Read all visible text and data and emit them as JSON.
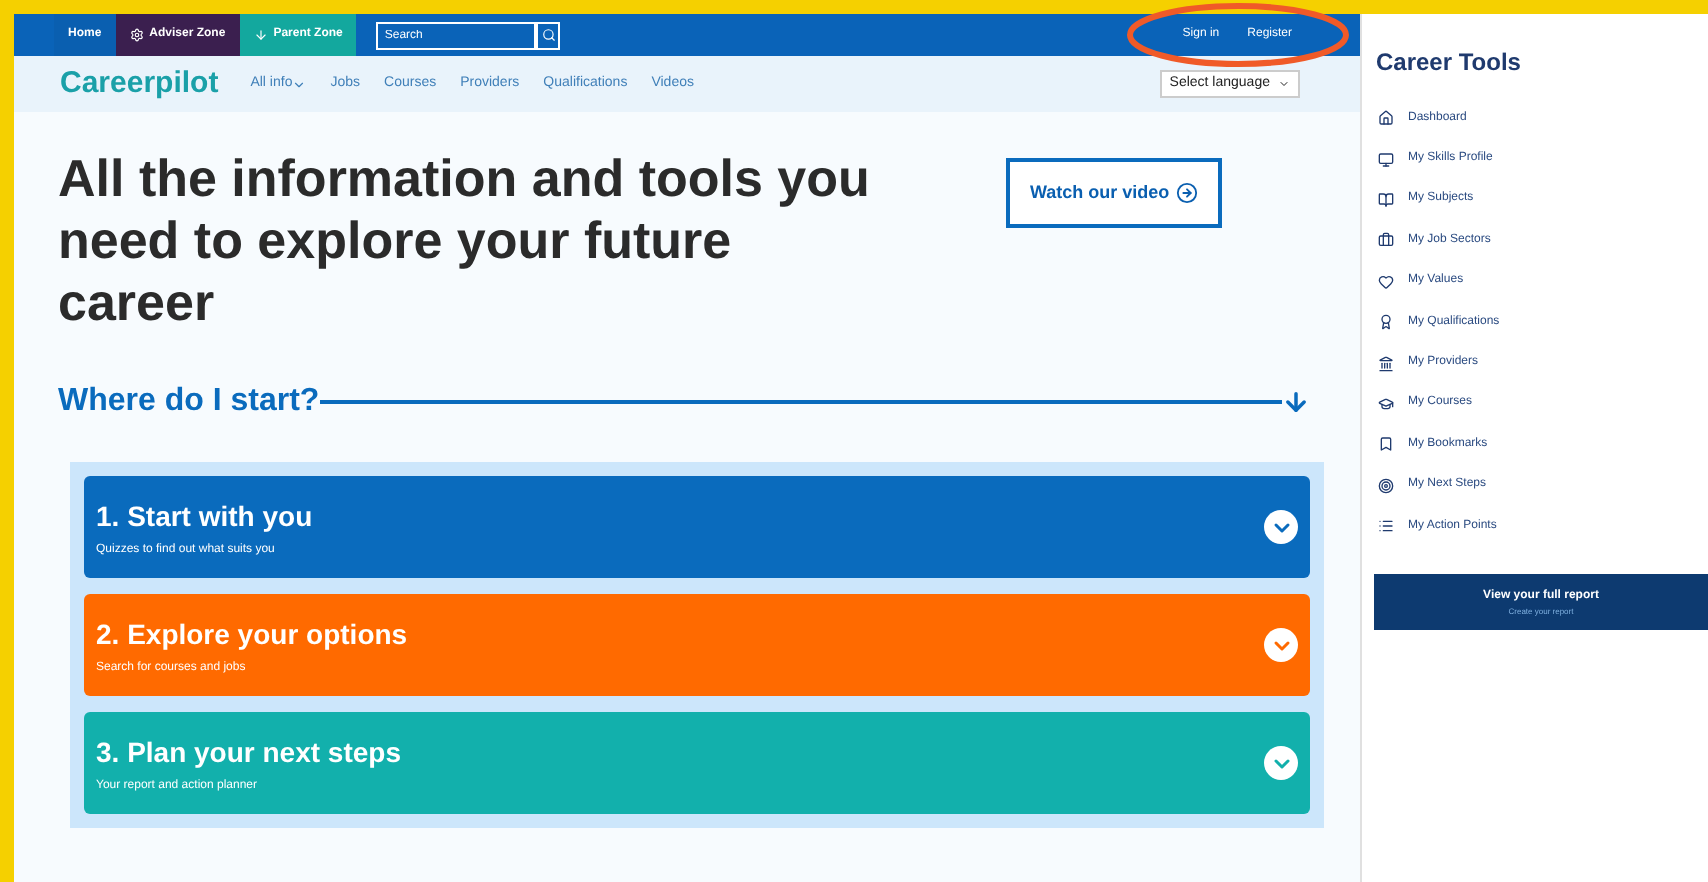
{
  "top_bar": {
    "links": [
      {
        "label": "Home",
        "kind": "plain"
      },
      {
        "label": "Adviser Zone",
        "kind": "adviser"
      },
      {
        "label": "Parent Zone",
        "kind": "parent"
      }
    ],
    "search": {
      "placeholder": "Search"
    },
    "account_links": [
      "Sign in",
      "Register"
    ]
  },
  "nav": {
    "logo": "Careerpilot",
    "items": [
      {
        "label": "All info",
        "dropdown": true
      },
      {
        "label": "Jobs",
        "dropdown": false
      },
      {
        "label": "Courses",
        "dropdown": false
      },
      {
        "label": "Providers",
        "dropdown": false
      },
      {
        "label": "Qualifications",
        "dropdown": false
      },
      {
        "label": "Videos",
        "dropdown": false
      }
    ],
    "language_select": "Select language"
  },
  "hero": {
    "heading": "All the information and tools you need to explore your future career",
    "video_button": "Watch our video"
  },
  "start": {
    "heading": "Where do I start?",
    "steps": [
      {
        "title": "1. Start with you",
        "subtitle": "Quizzes to find out what suits you",
        "color": "#0a6bbd"
      },
      {
        "title": "2. Explore your options",
        "subtitle": "Search for courses and jobs",
        "color": "#ff6a00"
      },
      {
        "title": "3. Plan your next steps",
        "subtitle": "Your report and action planner",
        "color": "#12b0ac"
      }
    ]
  },
  "sidebar": {
    "title": "Career Tools",
    "items": [
      {
        "label": "Dashboard",
        "kind": "home"
      },
      {
        "label": "My Skills Profile",
        "kind": "skills"
      },
      {
        "label": "My Subjects",
        "kind": "subjects"
      },
      {
        "label": "My Job Sectors",
        "kind": "jobs"
      },
      {
        "label": "My Values",
        "kind": "values"
      },
      {
        "label": "My Qualifications",
        "kind": "quals"
      },
      {
        "label": "My Providers",
        "kind": "providers"
      },
      {
        "label": "My Courses",
        "kind": "courses"
      },
      {
        "label": "My Bookmarks",
        "kind": "bookmarks"
      },
      {
        "label": "My Next Steps",
        "kind": "steps"
      },
      {
        "label": "My Action Points",
        "kind": "actions"
      }
    ],
    "report_button": "View your full report",
    "report_subtext": "Create your report"
  }
}
